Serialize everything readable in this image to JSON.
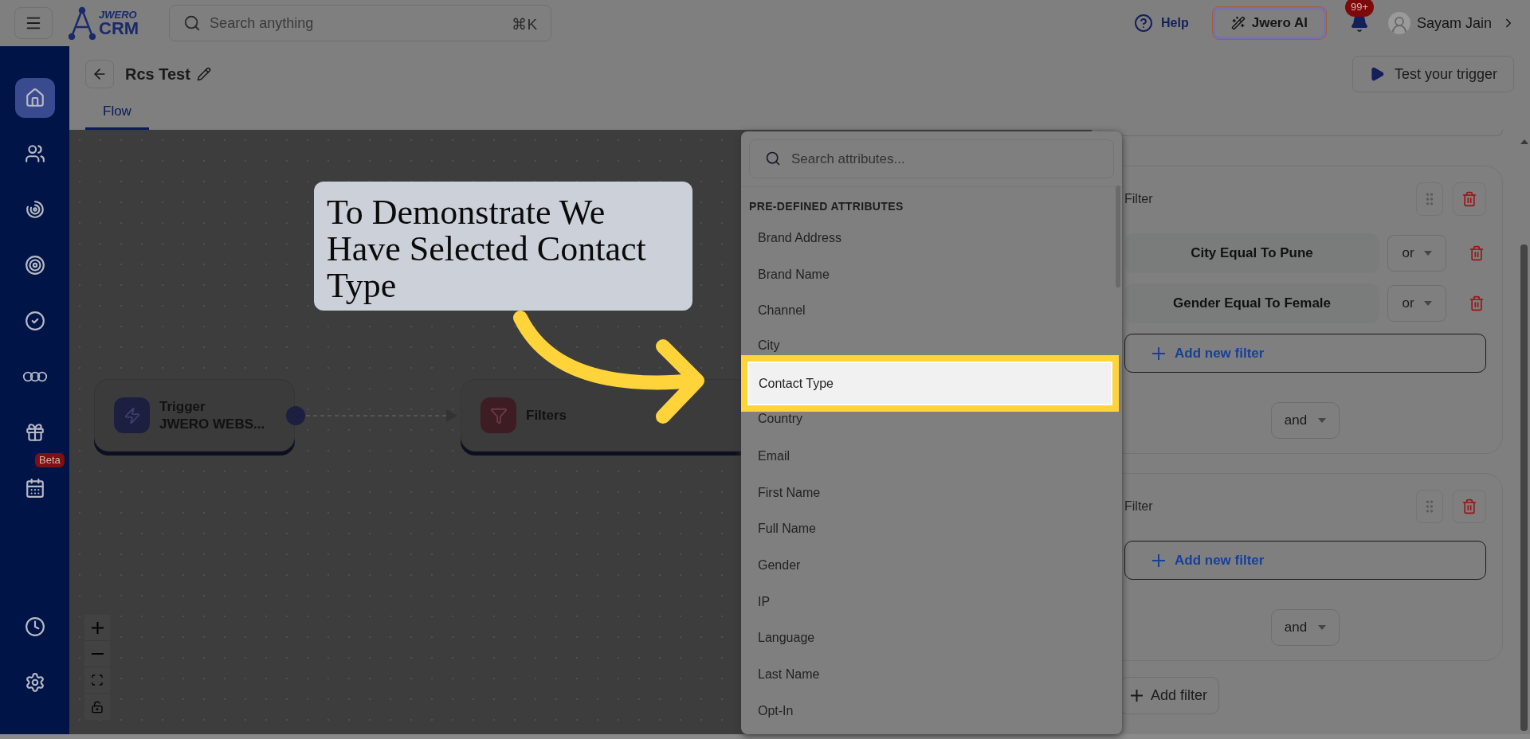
{
  "topbar": {
    "logo_top": "JWERO",
    "logo_bottom": "CRM",
    "search_placeholder": "Search anything",
    "shortcut": "⌘K",
    "help": "Help",
    "ai_button": "Jwero AI",
    "notification_badge": "99+",
    "user_name": "Sayam Jain"
  },
  "sidebar": {
    "items": [
      {
        "kind": "home",
        "selected": true
      },
      {
        "kind": "users",
        "selected": false
      },
      {
        "kind": "radar",
        "selected": false
      },
      {
        "kind": "target",
        "selected": false
      },
      {
        "kind": "check",
        "selected": false
      },
      {
        "kind": "chain",
        "selected": false
      },
      {
        "kind": "gift",
        "selected": false
      },
      {
        "kind": "calendar",
        "selected": false,
        "badge": "Beta"
      }
    ],
    "bottom_items": [
      {
        "kind": "clock",
        "selected": false
      },
      {
        "kind": "settings",
        "selected": false
      }
    ]
  },
  "header": {
    "title": "Rcs Test",
    "test_button": "Test your trigger"
  },
  "tabs": [
    {
      "label": "Flow",
      "selected": true
    }
  ],
  "canvas": {
    "nodes": [
      {
        "kind": "trigger",
        "title": "Trigger",
        "subtitle": "JWERO WEBS..."
      },
      {
        "kind": "filter",
        "title": "Filters"
      }
    ]
  },
  "callout": {
    "text": "To Demonstrate We Have Selected Contact Type"
  },
  "attribute_menu": {
    "placeholder": "Search attributes...",
    "section": "PRE-DEFINED ATTRIBUTES",
    "items": [
      {
        "label": "Brand Address",
        "selected": false
      },
      {
        "label": "Brand Name",
        "selected": false
      },
      {
        "label": "Channel",
        "selected": false
      },
      {
        "label": "City",
        "selected": false
      },
      {
        "label": "Contact Type",
        "selected": true
      },
      {
        "label": "Country",
        "selected": false
      },
      {
        "label": "Email",
        "selected": false
      },
      {
        "label": "First Name",
        "selected": false
      },
      {
        "label": "Full Name",
        "selected": false
      },
      {
        "label": "Gender",
        "selected": false
      },
      {
        "label": "IP",
        "selected": false
      },
      {
        "label": "Language",
        "selected": false
      },
      {
        "label": "Last Name",
        "selected": false
      },
      {
        "label": "Opt-In",
        "selected": false
      }
    ]
  },
  "filter_panel": {
    "groups": [
      {
        "label": "Filter",
        "conditions": [
          {
            "text": "City Equal To Pune",
            "operator": "or"
          },
          {
            "text": "Gender Equal To Female",
            "operator": "or"
          }
        ],
        "add_button": "Add new filter",
        "joiner": "and"
      },
      {
        "label": "Filter",
        "add_button": "Add new filter",
        "joiner": "and"
      }
    ],
    "add_filter": "Add filter"
  }
}
